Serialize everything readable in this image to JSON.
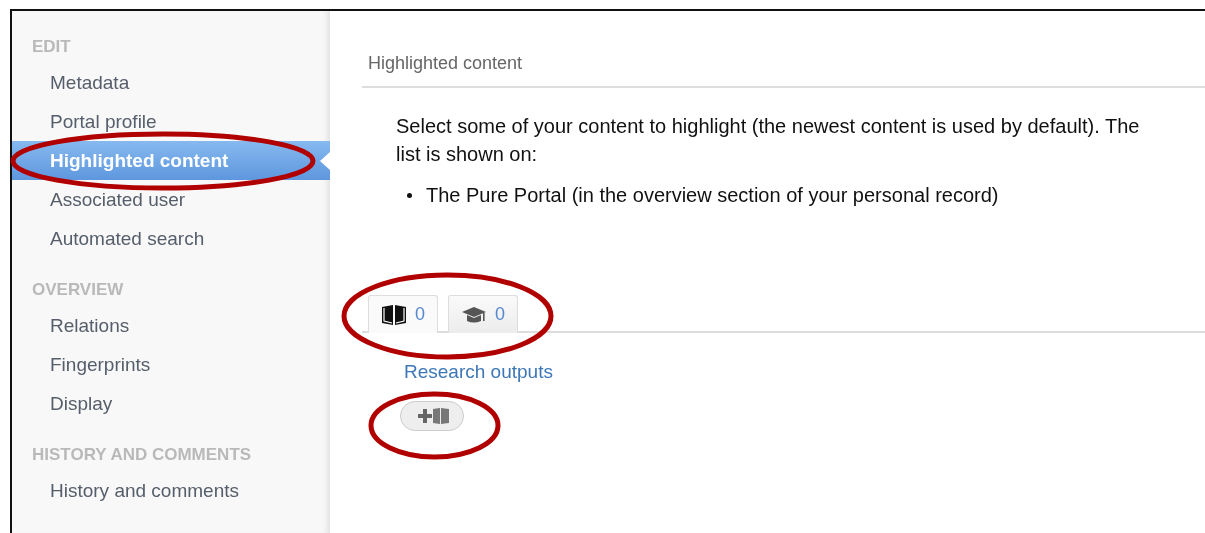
{
  "sidebar": {
    "sections": [
      {
        "heading": "EDIT",
        "items": [
          {
            "label": "Metadata",
            "selected": false
          },
          {
            "label": "Portal profile",
            "selected": false
          },
          {
            "label": "Highlighted content",
            "selected": true,
            "circled": true
          },
          {
            "label": "Associated user",
            "selected": false
          },
          {
            "label": "Automated search",
            "selected": false
          }
        ]
      },
      {
        "heading": "OVERVIEW",
        "items": [
          {
            "label": "Relations",
            "selected": false
          },
          {
            "label": "Fingerprints",
            "selected": false
          },
          {
            "label": "Display",
            "selected": false
          }
        ]
      },
      {
        "heading": "HISTORY AND COMMENTS",
        "items": [
          {
            "label": "History and comments",
            "selected": false
          }
        ]
      }
    ]
  },
  "content": {
    "title": "Highlighted content",
    "intro": "Select some of your content to highlight (the newest content is used by default). The list is shown on:",
    "bullets": [
      "The Pure Portal (in the overview section of your personal record)"
    ],
    "tabs_circled": true,
    "tabs": [
      {
        "kind": "book",
        "count": "0",
        "selected": true
      },
      {
        "kind": "cap",
        "count": "0",
        "selected": false
      }
    ],
    "section_link": "Research outputs",
    "add_button": {
      "circled": true
    }
  }
}
